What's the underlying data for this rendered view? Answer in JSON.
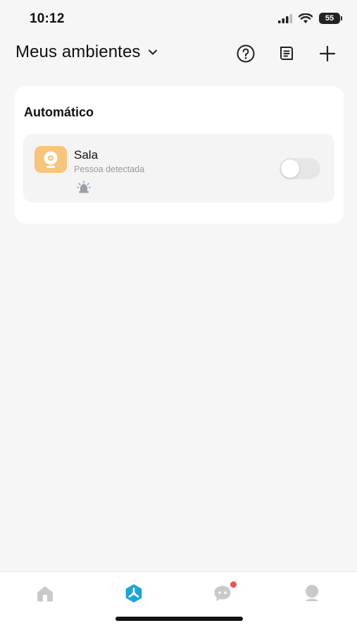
{
  "status_bar": {
    "time": "10:12",
    "battery": "55"
  },
  "header": {
    "title": "Meus ambientes",
    "icons": [
      "chevron-down-icon",
      "help-icon",
      "log-icon",
      "plus-icon"
    ]
  },
  "section": {
    "title": "Automático",
    "scenes": [
      {
        "name": "Sala",
        "subtitle": "Pessoa detectada",
        "enabled": false,
        "icon": "camera-icon",
        "icon_color": "#f8c57a",
        "action_icon": "alarm-icon"
      }
    ]
  },
  "bottom_nav": {
    "items": [
      {
        "icon": "home-icon",
        "active": false
      },
      {
        "icon": "scenes-icon",
        "active": true
      },
      {
        "icon": "messages-icon",
        "active": false,
        "has_notification": true
      },
      {
        "icon": "profile-icon",
        "active": false
      }
    ]
  },
  "colors": {
    "accent": "#1aa7d8",
    "inactive_icon": "#c9c9c9",
    "notification_dot": "#f0504f",
    "background": "#f6f6f6"
  }
}
